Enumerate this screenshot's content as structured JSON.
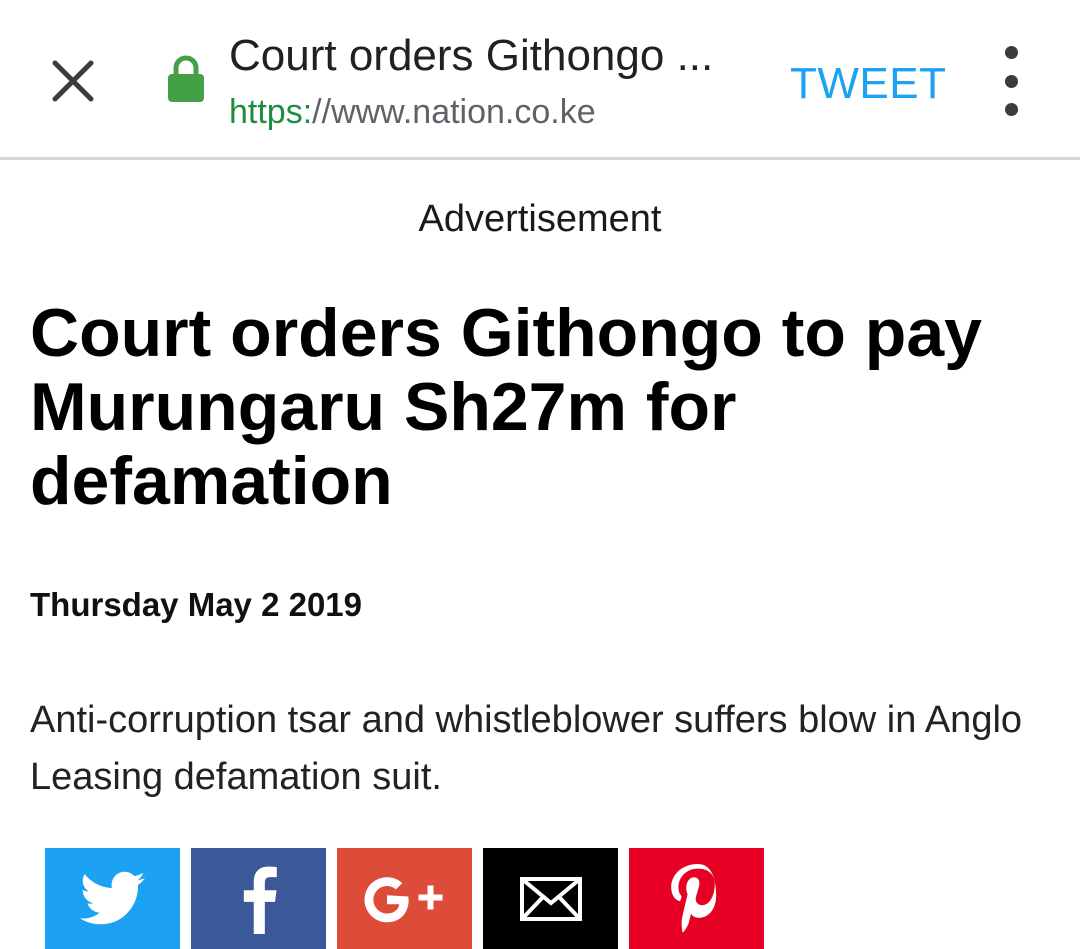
{
  "toolbar": {
    "close_icon": "close-icon",
    "lock_icon": "lock-icon",
    "lock_color": "#43a047",
    "title": "Court orders Githongo ...",
    "url_scheme": "https:",
    "url_rest": "//www.nation.co.ke",
    "tweet_label": "TWEET",
    "tweet_color": "#1da1f2",
    "menu_icon": "more-vert-icon"
  },
  "article": {
    "advertisement_label": "Advertisement",
    "headline": "Court orders Githongo to pay Murungaru Sh27m for defamation",
    "date": "Thursday May 2 2019",
    "summary": "Anti-corruption tsar and whistleblower suffers blow in Anglo Leasing defamation suit."
  },
  "share": {
    "buttons": [
      {
        "network": "twitter",
        "icon": "twitter-icon",
        "color": "#1da1f2"
      },
      {
        "network": "facebook",
        "icon": "facebook-icon",
        "color": "#3b5998"
      },
      {
        "network": "google-plus",
        "icon": "google-plus-icon",
        "label": "G+",
        "color": "#dd4b39"
      },
      {
        "network": "email",
        "icon": "email-icon",
        "color": "#000000"
      },
      {
        "network": "pinterest",
        "icon": "pinterest-icon",
        "color": "#e60023"
      }
    ]
  }
}
